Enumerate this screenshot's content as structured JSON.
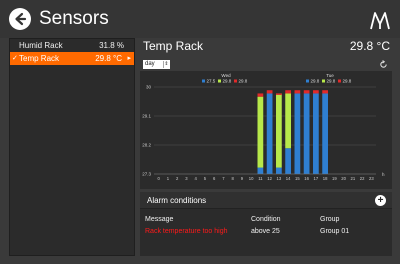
{
  "app": {
    "title": "Sensors"
  },
  "icons": {
    "back": "back-arrow-icon",
    "logo": "brand-logo-icon",
    "refresh": "refresh-icon",
    "add": "plus-icon"
  },
  "colors": {
    "accent": "#ff6a00",
    "series_wed_1": "#2f7fd1",
    "series_wed_2": "#b7e84a",
    "series_wed_3": "#e02a2a",
    "series_tue_1": "#2f7fd1",
    "series_tue_2": "#b7e84a",
    "series_tue_3": "#e02a2a",
    "alarm_message": "#ff1a1a"
  },
  "sidebar": {
    "items": [
      {
        "label": "Humid Rack",
        "value": "31.8 %",
        "active": false
      },
      {
        "label": "Temp Rack",
        "value": "29.8 °C",
        "active": true
      }
    ]
  },
  "main": {
    "title": "Temp Rack",
    "value": "29.8 °C",
    "period": "day"
  },
  "chart_data": {
    "type": "bar",
    "legend": [
      {
        "group": "Wed",
        "entries": [
          "27.5",
          "29.8",
          "29.8"
        ]
      },
      {
        "group": "Tue",
        "entries": [
          "29.8",
          "29.8",
          "29.8"
        ]
      }
    ],
    "y_ticks": [
      "30",
      "29.1",
      "28.2",
      "27.3"
    ],
    "ylim": [
      27.3,
      30
    ],
    "x_ticks": [
      "0",
      "1",
      "2",
      "3",
      "4",
      "5",
      "6",
      "7",
      "8",
      "9",
      "10",
      "11",
      "12",
      "13",
      "14",
      "15",
      "16",
      "17",
      "18",
      "19",
      "20",
      "21",
      "22",
      "23"
    ],
    "x_unit": "h",
    "series": [
      {
        "color": "#2f7fd1",
        "values": [
          null,
          null,
          null,
          null,
          null,
          null,
          null,
          null,
          null,
          null,
          null,
          27.5,
          29.8,
          27.5,
          28.1,
          29.8,
          29.8,
          29.8,
          29.8,
          null,
          null,
          null,
          null,
          null
        ]
      },
      {
        "color": "#b7e84a",
        "values": [
          null,
          null,
          null,
          null,
          null,
          null,
          null,
          null,
          null,
          null,
          null,
          29.7,
          null,
          29.8,
          29.8,
          null,
          null,
          null,
          null,
          null,
          null,
          null,
          null,
          null
        ]
      },
      {
        "color": "#e02a2a",
        "values": [
          null,
          null,
          null,
          null,
          null,
          null,
          null,
          null,
          null,
          null,
          null,
          29.8,
          29.9,
          29.8,
          29.9,
          29.9,
          29.9,
          29.9,
          29.9,
          null,
          null,
          null,
          null,
          null
        ]
      }
    ]
  },
  "alarms": {
    "title": "Alarm conditions",
    "columns": [
      "Message",
      "Condition",
      "Group"
    ],
    "rows": [
      {
        "message": "Rack temperature too high",
        "condition": "above 25",
        "group": "Group 01"
      }
    ]
  }
}
